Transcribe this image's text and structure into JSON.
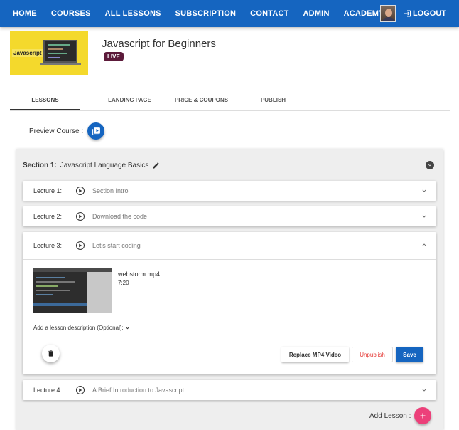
{
  "nav": {
    "items": [
      "HOME",
      "COURSES",
      "ALL LESSONS",
      "SUBSCRIPTION",
      "CONTACT",
      "ADMIN",
      "ACADEMY"
    ],
    "logout_label": "LOGOUT"
  },
  "course": {
    "thumbnail_label": "Javascript",
    "title": "Javascript for Beginners",
    "status_badge": "LIVE"
  },
  "tabs": [
    "LESSONS",
    "LANDING PAGE",
    "PRICE & COUPONS",
    "PUBLISH"
  ],
  "preview": {
    "label": "Preview Course :"
  },
  "section": {
    "number_label": "Section 1:",
    "title": "Javascript Language Basics"
  },
  "lectures": [
    {
      "number_label": "Lecture 1:",
      "title": "Section Intro"
    },
    {
      "number_label": "Lecture 2:",
      "title": "Download the code"
    },
    {
      "number_label": "Lecture 3:",
      "title": "Let's start coding"
    },
    {
      "number_label": "Lecture 4:",
      "title": "A Brief Introduction to Javascript"
    }
  ],
  "expanded_lecture": {
    "file_name": "webstorm.mp4",
    "duration": "7:20",
    "description_toggle": "Add a lesson description (Optional):",
    "replace_label": "Replace MP4 Video",
    "unpublish_label": "Unpublish",
    "save_label": "Save"
  },
  "add_lesson": {
    "label": "Add Lesson :"
  },
  "colors": {
    "topbar": "#1565c0",
    "live_badge": "#5c1a3a",
    "save_button": "#1565c0",
    "unpublish_text": "#e53935",
    "add_button": "#ec407a"
  },
  "icons": {
    "logout": "logout-icon",
    "preview": "play-box-icon",
    "edit": "pencil-icon",
    "collapse": "chevron-circle-down-icon",
    "lecture_play": "play-circle-icon",
    "expand": "chevron-down-icon",
    "collapse_lecture": "chevron-up-icon",
    "delete": "trash-icon",
    "add": "plus-icon"
  }
}
